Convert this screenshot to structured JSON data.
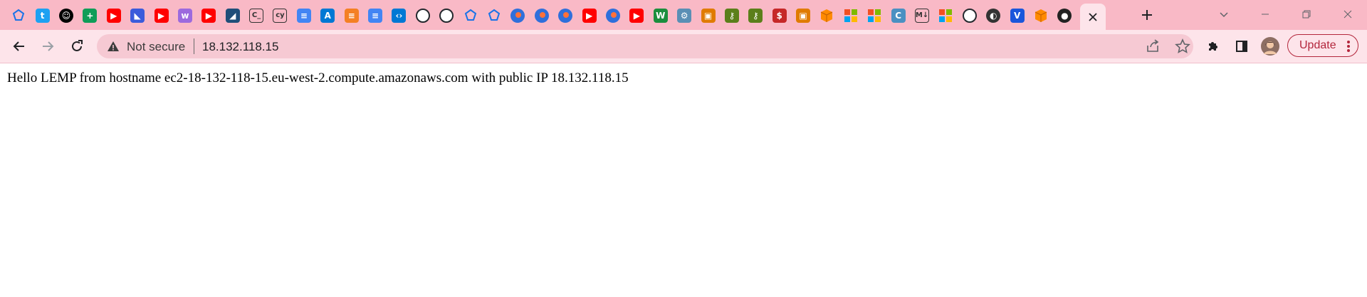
{
  "browser": {
    "tabs": [
      {
        "icon": "pentagon-logo-icon",
        "color": "#1a73e8"
      },
      {
        "icon": "twitter-t-icon",
        "color": "#1da1f2"
      },
      {
        "icon": "smiley-face-icon",
        "color": "#000000"
      },
      {
        "icon": "green-plus-icon",
        "color": "#0f9d58"
      },
      {
        "icon": "youtube-icon",
        "color": "#ff0000"
      },
      {
        "icon": "blue-chart-icon",
        "color": "#3b5bdb"
      },
      {
        "icon": "youtube-icon",
        "color": "#ff0000"
      },
      {
        "icon": "purple-w-icon",
        "color": "#9c6ade"
      },
      {
        "icon": "youtube-icon",
        "color": "#ff0000"
      },
      {
        "icon": "azure-sql-icon",
        "color": "#1f4e79"
      },
      {
        "icon": "code-terminal-icon",
        "color": "#333333"
      },
      {
        "icon": "cy-icon",
        "color": "#333333"
      },
      {
        "icon": "google-docs-icon",
        "color": "#4285f4"
      },
      {
        "icon": "azure-a-icon",
        "color": "#0078d4"
      },
      {
        "icon": "stack-overflow-icon",
        "color": "#f48024"
      },
      {
        "icon": "google-docs-icon",
        "color": "#4285f4"
      },
      {
        "icon": "vscode-icon",
        "color": "#0078d4"
      },
      {
        "icon": "github-icon",
        "color": "#ffffff"
      },
      {
        "icon": "github-icon",
        "color": "#ffffff"
      },
      {
        "icon": "pentagon-logo-icon",
        "color": "#1a73e8"
      },
      {
        "icon": "pentagon-logo-icon",
        "color": "#1a73e8"
      },
      {
        "icon": "firefox-blue-icon",
        "color": "#2f6fdb"
      },
      {
        "icon": "firefox-blue-icon",
        "color": "#2f6fdb"
      },
      {
        "icon": "firefox-blue-icon",
        "color": "#2f6fdb"
      },
      {
        "icon": "youtube-icon",
        "color": "#ff0000"
      },
      {
        "icon": "firefox-blue-icon",
        "color": "#2f6fdb"
      },
      {
        "icon": "youtube-icon",
        "color": "#ff0000"
      },
      {
        "icon": "w-green-icon",
        "color": "#1b8e3d"
      },
      {
        "icon": "globe-gear-icon",
        "color": "#5a8fb5"
      },
      {
        "icon": "orange-squares-icon",
        "color": "#e07b00"
      },
      {
        "icon": "key-green-icon",
        "color": "#5b7f1a"
      },
      {
        "icon": "key-green-icon",
        "color": "#5b7f1a"
      },
      {
        "icon": "red-box-icon",
        "color": "#c62828"
      },
      {
        "icon": "orange-squares-icon",
        "color": "#e07b00"
      },
      {
        "icon": "orange-cube-icon",
        "color": "#ff8a00"
      },
      {
        "icon": "microsoft-logo-icon",
        "color": "#f25022"
      },
      {
        "icon": "microsoft-logo-icon",
        "color": "#f25022"
      },
      {
        "icon": "blue-c-icon",
        "color": "#4a90c2"
      },
      {
        "icon": "markdown-icon",
        "color": "#333333"
      },
      {
        "icon": "microsoft-logo-icon",
        "color": "#f25022"
      },
      {
        "icon": "github-icon",
        "color": "#ffffff"
      },
      {
        "icon": "whale-icon",
        "color": "#333333"
      },
      {
        "icon": "v-blue-icon",
        "color": "#1a56db"
      },
      {
        "icon": "orange-cube-icon",
        "color": "#ff8a00"
      },
      {
        "icon": "globe-dark-icon",
        "color": "#222222"
      }
    ],
    "active_tab": {
      "icon": "close-icon"
    },
    "new_tab": {
      "icon": "plus-icon"
    },
    "omnibox": {
      "security_label": "Not secure",
      "url": "18.132.118.15"
    },
    "update_label": "Update"
  },
  "page": {
    "text": "Hello LEMP from hostname ec2-18-132-118-15.eu-west-2.compute.amazonaws.com with public IP 18.132.118.15"
  },
  "colors": {
    "titlebar": "#f9b9c6",
    "toolbar": "#fde4ea",
    "accent": "#b3263c"
  }
}
